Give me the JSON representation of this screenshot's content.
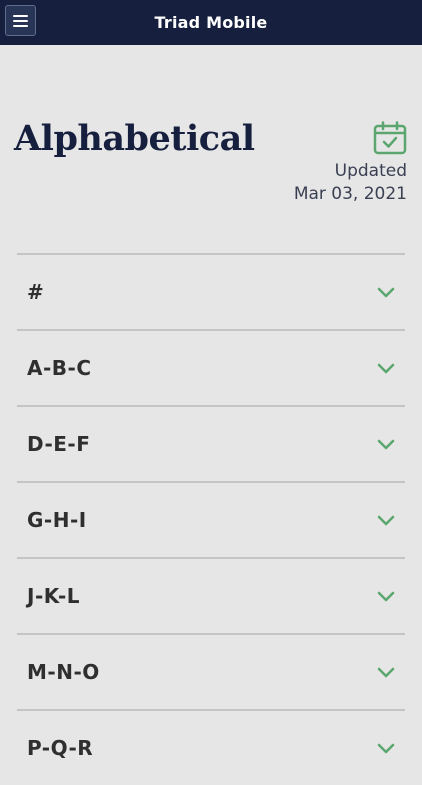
{
  "app": {
    "title": "Triad Mobile",
    "menu_icon": "hamburger-menu-icon"
  },
  "header": {
    "title": "Alphabetical",
    "updated_label": "Updated",
    "updated_date": "Mar 03, 2021",
    "calendar_icon": "calendar-check-icon"
  },
  "sections": [
    {
      "label": "#"
    },
    {
      "label": "A-B-C"
    },
    {
      "label": "D-E-F"
    },
    {
      "label": "G-H-I"
    },
    {
      "label": "J-K-L"
    },
    {
      "label": "M-N-O"
    },
    {
      "label": "P-Q-R"
    }
  ],
  "colors": {
    "nav_background": "#16203e",
    "page_background": "#e6e6e6",
    "accent_green": "#5aa66e",
    "title_navy": "#16203e"
  }
}
